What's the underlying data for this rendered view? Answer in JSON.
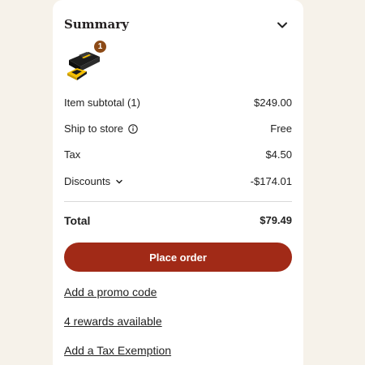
{
  "summary": {
    "title": "Summary",
    "toggle_icon": "chevron-down-icon",
    "item_image": "power-tool-battery-charger-image",
    "item_count_badge": "1"
  },
  "lines": {
    "item_subtotal": {
      "label": "Item subtotal (1)",
      "value": "$249.00"
    },
    "ship_to_store": {
      "label": "Ship to store",
      "value": "Free",
      "icon": "info-icon"
    },
    "tax": {
      "label": "Tax",
      "value": "$4.50"
    },
    "discounts": {
      "label": "Discounts",
      "value": "-$174.01",
      "icon": "chevron-down-icon"
    }
  },
  "total": {
    "label": "Total",
    "value": "$79.49"
  },
  "actions": {
    "place_order": "Place order",
    "promo_link": "Add a promo code",
    "rewards_link": "4 rewards available",
    "tax_exemption_link": "Add a Tax Exemption"
  },
  "colors": {
    "primary_button": "#a12a17",
    "badge": "#8c4a16",
    "page_background": "#f6f2ea"
  }
}
